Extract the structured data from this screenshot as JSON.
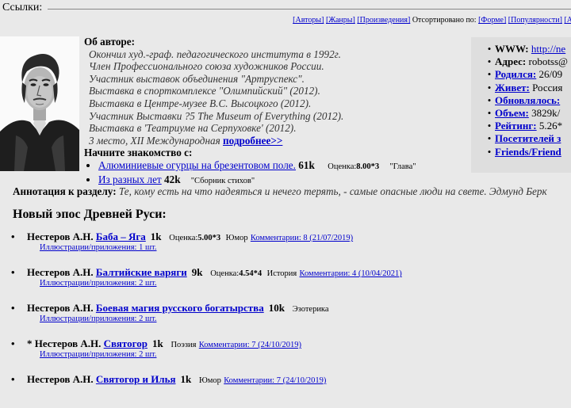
{
  "topbar": {
    "label": "Ссылки:"
  },
  "sortbar": {
    "authors": "[Авторы]",
    "genres": "[Жанры]",
    "works": "[Произведения]",
    "sorted_by": "Отсортировано по:",
    "form": "[Форме]",
    "popularity": "[Популярности]",
    "more": "[А"
  },
  "about": {
    "title": "Об авторе:",
    "bio": [
      "Окончил худ.-граф. педагогического института в 1992г.",
      "Член Профессионального союза художников России.",
      "Участник выставок объединения \"Артруспекс\".",
      "Выставка в спорткомплексе \"Олимпийский\" (2012).",
      "Выставка в Центре-музее В.С. Высоцкого (2012).",
      "Участник Выставки ?5 The Museum of Everything (2012).",
      "Выставка в 'Театриуме на Серпуховке' (2012).",
      "3 место, XII Международная"
    ],
    "more_link": "подробнее>>",
    "start_title": "Начните знакомство с",
    "start_items": [
      {
        "title": "Алюминиевые огурцы на брезентовом поле.",
        "size": "61k",
        "rating_label": "Оценка:",
        "rating": "8.00*3",
        "genre": "\"Глава\""
      },
      {
        "title": "Из разных лет",
        "size": "42k",
        "genre": "\"Сборник стихов\""
      }
    ]
  },
  "annotation": {
    "label": "Аннотация к разделу:",
    "text": "Те, кому есть на что надеяться и нечего терять, - самые опасные люди на свете. Эдмунд Берк"
  },
  "info": {
    "rows": [
      {
        "key": "WWW:",
        "value": "http://ne",
        "link": true,
        "underline_key": false
      },
      {
        "key": "Адрес:",
        "value": "robotss@",
        "link": false,
        "underline_key": false
      },
      {
        "key": "Родился:",
        "value": "26/09",
        "link": false,
        "underline_key": true
      },
      {
        "key": "Живет:",
        "value": "Россия",
        "link": false,
        "underline_key": true
      },
      {
        "key": "Обновлялось:",
        "value": "",
        "link": false,
        "underline_key": true
      },
      {
        "key": "Объем:",
        "value": "3829k/",
        "link": false,
        "underline_key": true
      },
      {
        "key": "Рейтинг:",
        "value": "5.26*",
        "link": false,
        "underline_key": true
      },
      {
        "key": "Посетителей з",
        "value": "",
        "link": false,
        "underline_key": true
      },
      {
        "key": "Friends/Friend",
        "value": "",
        "link": false,
        "underline_key": true
      }
    ]
  },
  "section": {
    "title": "Новый эпос Древней Руси:"
  },
  "works": [
    {
      "prefix": "",
      "author": "Нестеров А.Н.",
      "title": "Баба – Яга",
      "size": "1k",
      "rating_label": "Оценка:",
      "rating": "5.00*3",
      "genre": "Юмор",
      "comments": "Комментарии: 8 (21/07/2019)",
      "sub": "Иллюстрации/приложения: 1 шт."
    },
    {
      "prefix": "",
      "author": "Нестеров А.Н.",
      "title": "Балтийские варяги",
      "size": "9k",
      "rating_label": "Оценка:",
      "rating": "4.54*4",
      "genre": "История",
      "comments": "Комментарии: 4 (10/04/2021)",
      "sub": "Иллюстрации/приложения: 2 шт."
    },
    {
      "prefix": "",
      "author": "Нестеров А.Н.",
      "title": "Боевая магия русского богатырства",
      "size": "10k",
      "rating_label": "",
      "rating": "",
      "genre": "Эзотерика",
      "comments": "",
      "sub": "Иллюстрации/приложения: 2 шт."
    },
    {
      "prefix": "* ",
      "author": "Нестеров А.Н.",
      "title": "Святогор",
      "size": "1k",
      "rating_label": "",
      "rating": "",
      "genre": "Поэзия",
      "comments": "Комментарии: 7 (24/10/2019)",
      "sub": "Иллюстрации/приложения: 2 шт."
    },
    {
      "prefix": "",
      "author": "Нестеров А.Н.",
      "title": "Святогор и Илья",
      "size": "1k",
      "rating_label": "",
      "rating": "",
      "genre": "Юмор",
      "comments": "Комментарии: 7 (24/10/2019)",
      "sub": ""
    }
  ]
}
